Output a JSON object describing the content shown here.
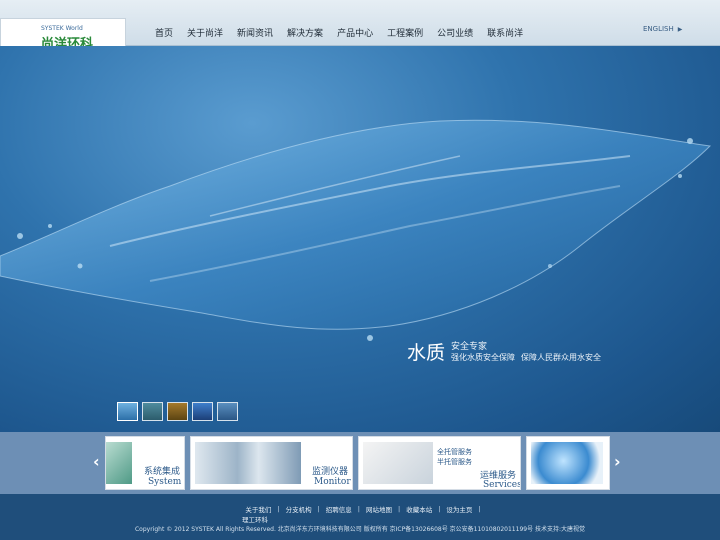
{
  "header": {
    "logo_top": "SYSTEK World",
    "logo_name": "尚洋环科",
    "nav": [
      "首页",
      "关于尚洋",
      "新闻资讯",
      "解决方案",
      "产品中心",
      "工程案例",
      "公司业绩",
      "联系尚洋"
    ],
    "lang": "ENGLISH"
  },
  "hero": {
    "big": "水质",
    "line1": "安全专家",
    "line2": "强化水质安全保障",
    "line3": "保障人民群众用水安全",
    "thumb_count": 5
  },
  "products": [
    {
      "cn": "系统集成",
      "en": "System"
    },
    {
      "cn": "监测仪器",
      "en": "Monitor"
    },
    {
      "cn": "运维服务",
      "en": "Services",
      "sub1": "全托管服务",
      "sub2": "半托管服务"
    },
    {
      "cn": "",
      "en": ""
    }
  ],
  "nav_arrows": {
    "left": "‹",
    "right": "›"
  },
  "footer": {
    "links": [
      "关于我们",
      "分支机构",
      "招聘信息",
      "网站地图",
      "收藏本站",
      "设为主页"
    ],
    "extra_link": "理工环科",
    "copyright": "Copyright © 2012 SYSTEK All Rights Reserved. 北京尚洋东方环境科技有限公司 版权所有 京ICP备13026608号 京公安备11010802011199号 技术支持:大唐视觉"
  },
  "colors": {
    "accent": "#2c5a8a",
    "hero": "#1d568d",
    "strip": "#6d8fb5",
    "footer": "#1f4e7b"
  }
}
